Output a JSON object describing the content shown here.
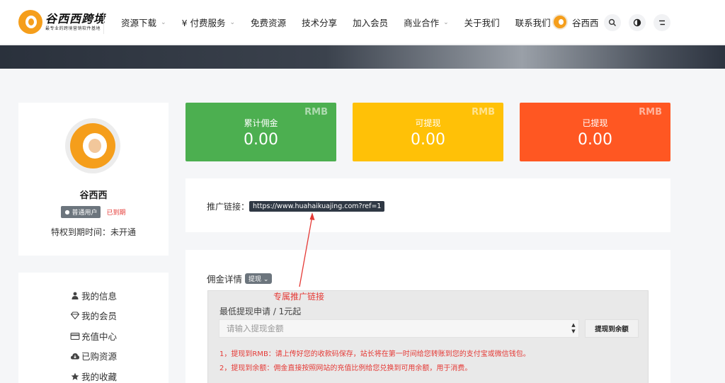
{
  "brand": {
    "title": "谷西西跨境",
    "subtitle": "最专业的跨境营销软件基地",
    "accent": "#f59e1b"
  },
  "nav": {
    "items": [
      {
        "label": "资源下载",
        "has_dropdown": true
      },
      {
        "label": "¥ 付费服务",
        "has_dropdown": true
      },
      {
        "label": "免费资源",
        "has_dropdown": false
      },
      {
        "label": "技术分享",
        "has_dropdown": false
      },
      {
        "label": "加入会员",
        "has_dropdown": false
      },
      {
        "label": "商业合作",
        "has_dropdown": true
      },
      {
        "label": "关于我们",
        "has_dropdown": false
      },
      {
        "label": "联系我们",
        "has_dropdown": false
      }
    ],
    "username": "谷西西",
    "icons": [
      "search-icon",
      "theme-toggle-icon",
      "menu-icon"
    ]
  },
  "profile": {
    "name": "谷西西",
    "badge": "普通用户",
    "status": "已到期",
    "privilege": "特权到期时间：未开通"
  },
  "sidebar_menu": [
    {
      "icon": "user-icon",
      "label": "我的信息"
    },
    {
      "icon": "diamond-icon",
      "label": "我的会员"
    },
    {
      "icon": "credit-card-icon",
      "label": "充值中心"
    },
    {
      "icon": "cloud-download-icon",
      "label": "已购资源"
    },
    {
      "icon": "star-icon",
      "label": "我的收藏"
    }
  ],
  "stats": [
    {
      "tag": "RMB",
      "label": "累计佣金",
      "value": "0.00",
      "color": "#4caf50"
    },
    {
      "tag": "RMB",
      "label": "可提现",
      "value": "0.00",
      "color": "#ffc107"
    },
    {
      "tag": "RMB",
      "label": "已提现",
      "value": "0.00",
      "color": "#ff5722"
    }
  ],
  "promo": {
    "label": "推广链接：",
    "url": "https://www.huahaikuajing.com?ref=1"
  },
  "commission": {
    "title": "佣金详情",
    "withdraw_label": "提现",
    "annotation": "专属推广链接",
    "min_label": "最低提现申请 / 1元起",
    "input_placeholder": "请输入提现金额",
    "to_balance_button": "提现到余额",
    "notes": [
      "1，提现到RMB：请上传好您的收款码保存，站长将在第一时间给您转账到您的支付宝或微信钱包。",
      "2，提现到余额：佣金直接按照网站的充值比例给您兑换到可用余额，用于消费。"
    ]
  },
  "colors": {
    "annotation": "#e53935",
    "dark": "#2f3844"
  }
}
